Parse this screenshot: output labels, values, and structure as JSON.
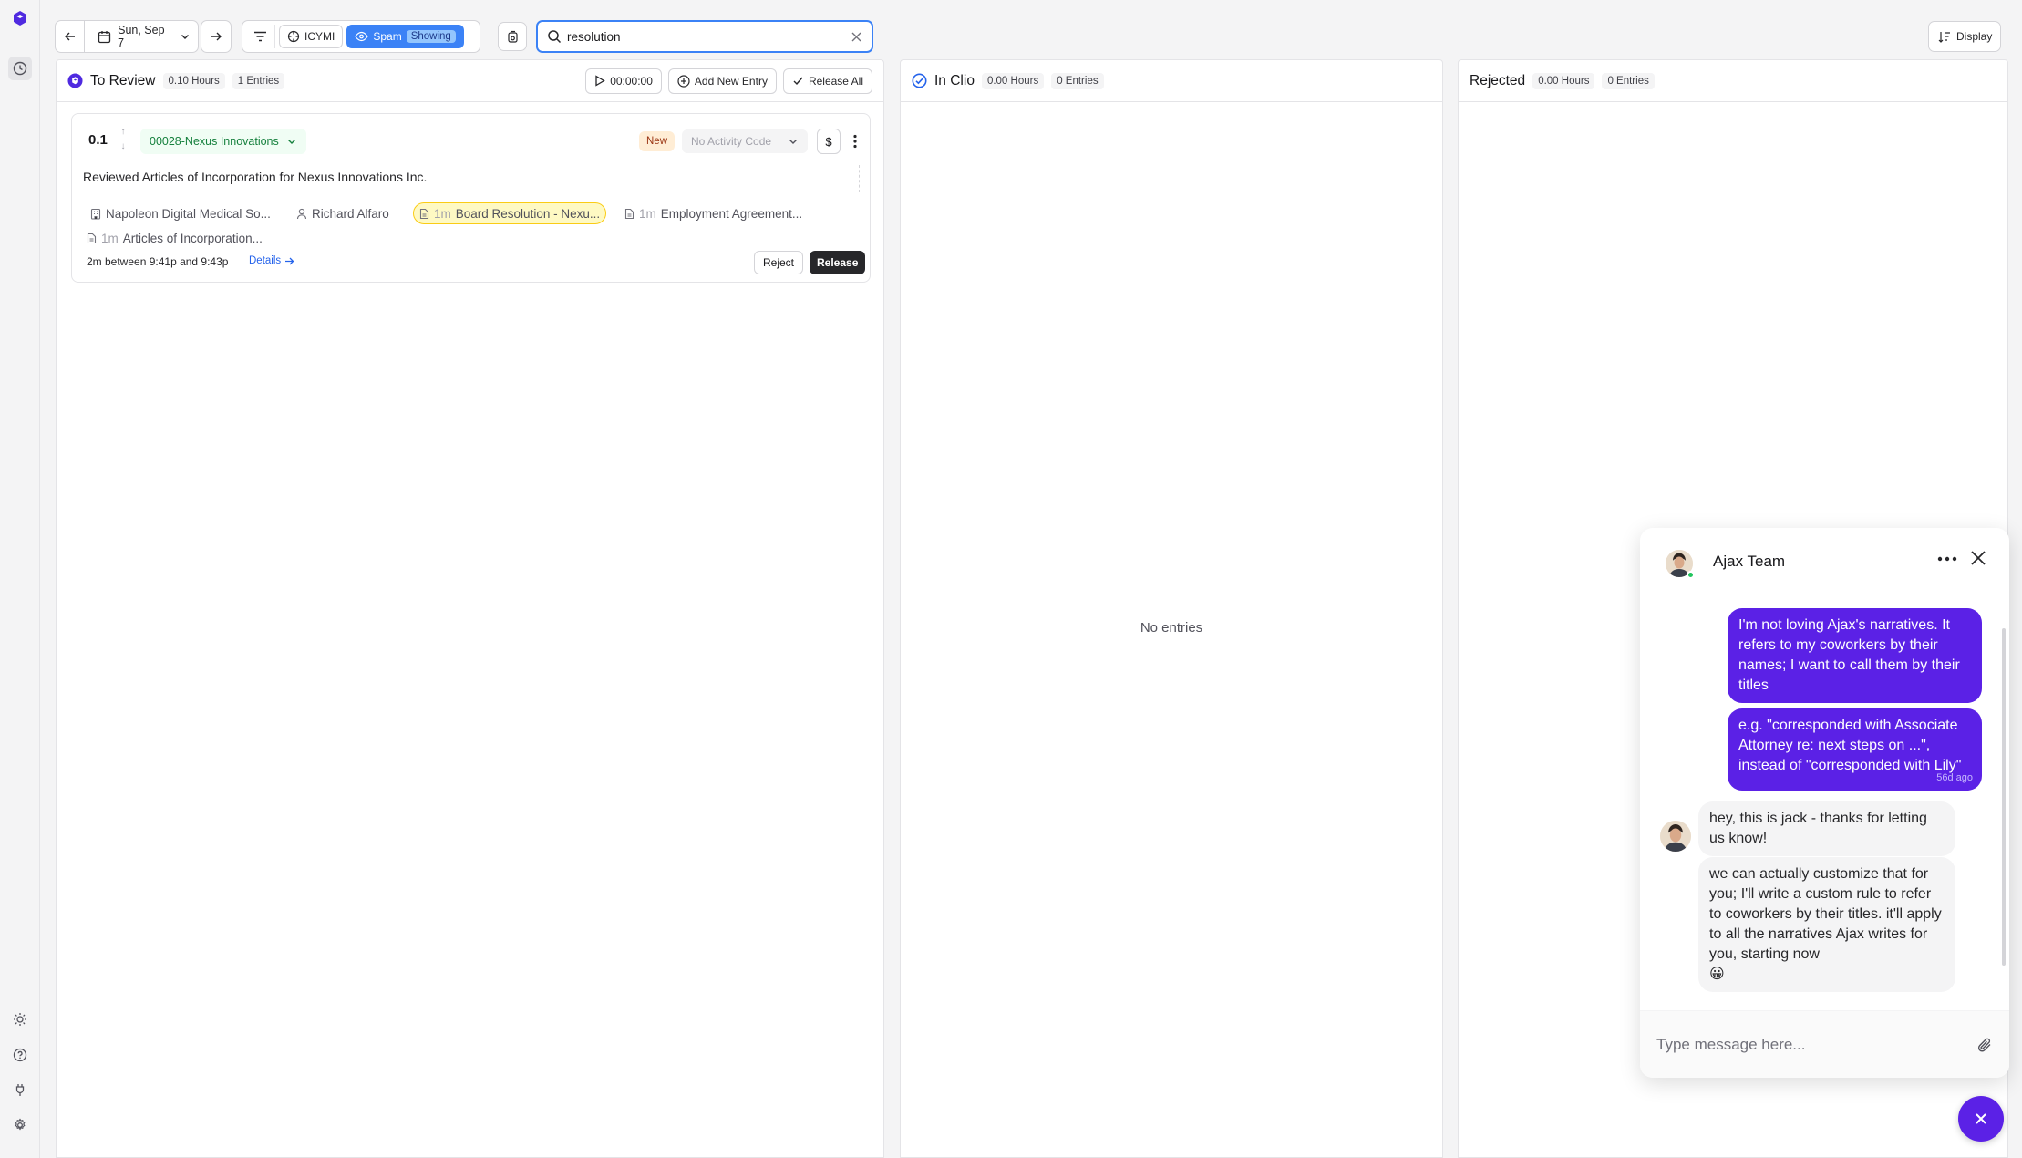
{
  "toolbar": {
    "date_label": "Sun, Sep 7",
    "icymi_label": "ICYMI",
    "spam_label": "Spam",
    "spam_state": "Showing",
    "search_value": "resolution",
    "display_label": "Display"
  },
  "columns": {
    "review": {
      "title": "To Review",
      "hours": "0.10 Hours",
      "entries": "1 Entries",
      "timer": "00:00:00",
      "add_entry_label": "Add New Entry",
      "release_all_label": "Release All"
    },
    "clio": {
      "title": "In Clio",
      "hours": "0.00 Hours",
      "entries": "0 Entries",
      "empty": "No entries"
    },
    "rejected": {
      "title": "Rejected",
      "hours": "0.00 Hours",
      "entries": "0 Entries"
    }
  },
  "entry": {
    "hours": "0.1",
    "matter": "00028-Nexus Innovations",
    "status": "New",
    "activity_code": "No Activity Code",
    "billable_symbol": "$",
    "narrative": "Reviewed Articles of Incorporation for Nexus Innovations Inc.",
    "tags": {
      "client": "Napoleon Digital Medical So...",
      "person": "Richard Alfaro",
      "doc1_time": "1m",
      "doc1_name": "Board Resolution - Nexu...",
      "doc2_time": "1m",
      "doc2_name": "Employment Agreement...",
      "doc3_time": "1m",
      "doc3_name": "Articles of Incorporation..."
    },
    "time_range": "2m between 9:41p and 9:43p",
    "details_label": "Details",
    "reject_label": "Reject",
    "release_label": "Release"
  },
  "chat": {
    "title": "Ajax Team",
    "messages": {
      "m1": "I'm not loving Ajax's narratives. It refers to my coworkers by their names; I want to call them by their titles",
      "m2": "e.g. \"corresponded with Associate Attorney re: next steps on ...\", instead of \"corresponded with Lily\"",
      "m2_time": "56d ago",
      "m3": "hey, this is jack - thanks for letting us know!",
      "m4": "we can actually customize that for you; I'll write a custom rule to refer to coworkers by their titles. it'll apply to all the narratives Ajax writes for you, starting now",
      "m4_emoji": "😀"
    },
    "input_placeholder": "Type message here..."
  },
  "colors": {
    "accent": "#3b82f6",
    "chat_brand": "#5b21e6",
    "matter_green": "#15803d"
  }
}
